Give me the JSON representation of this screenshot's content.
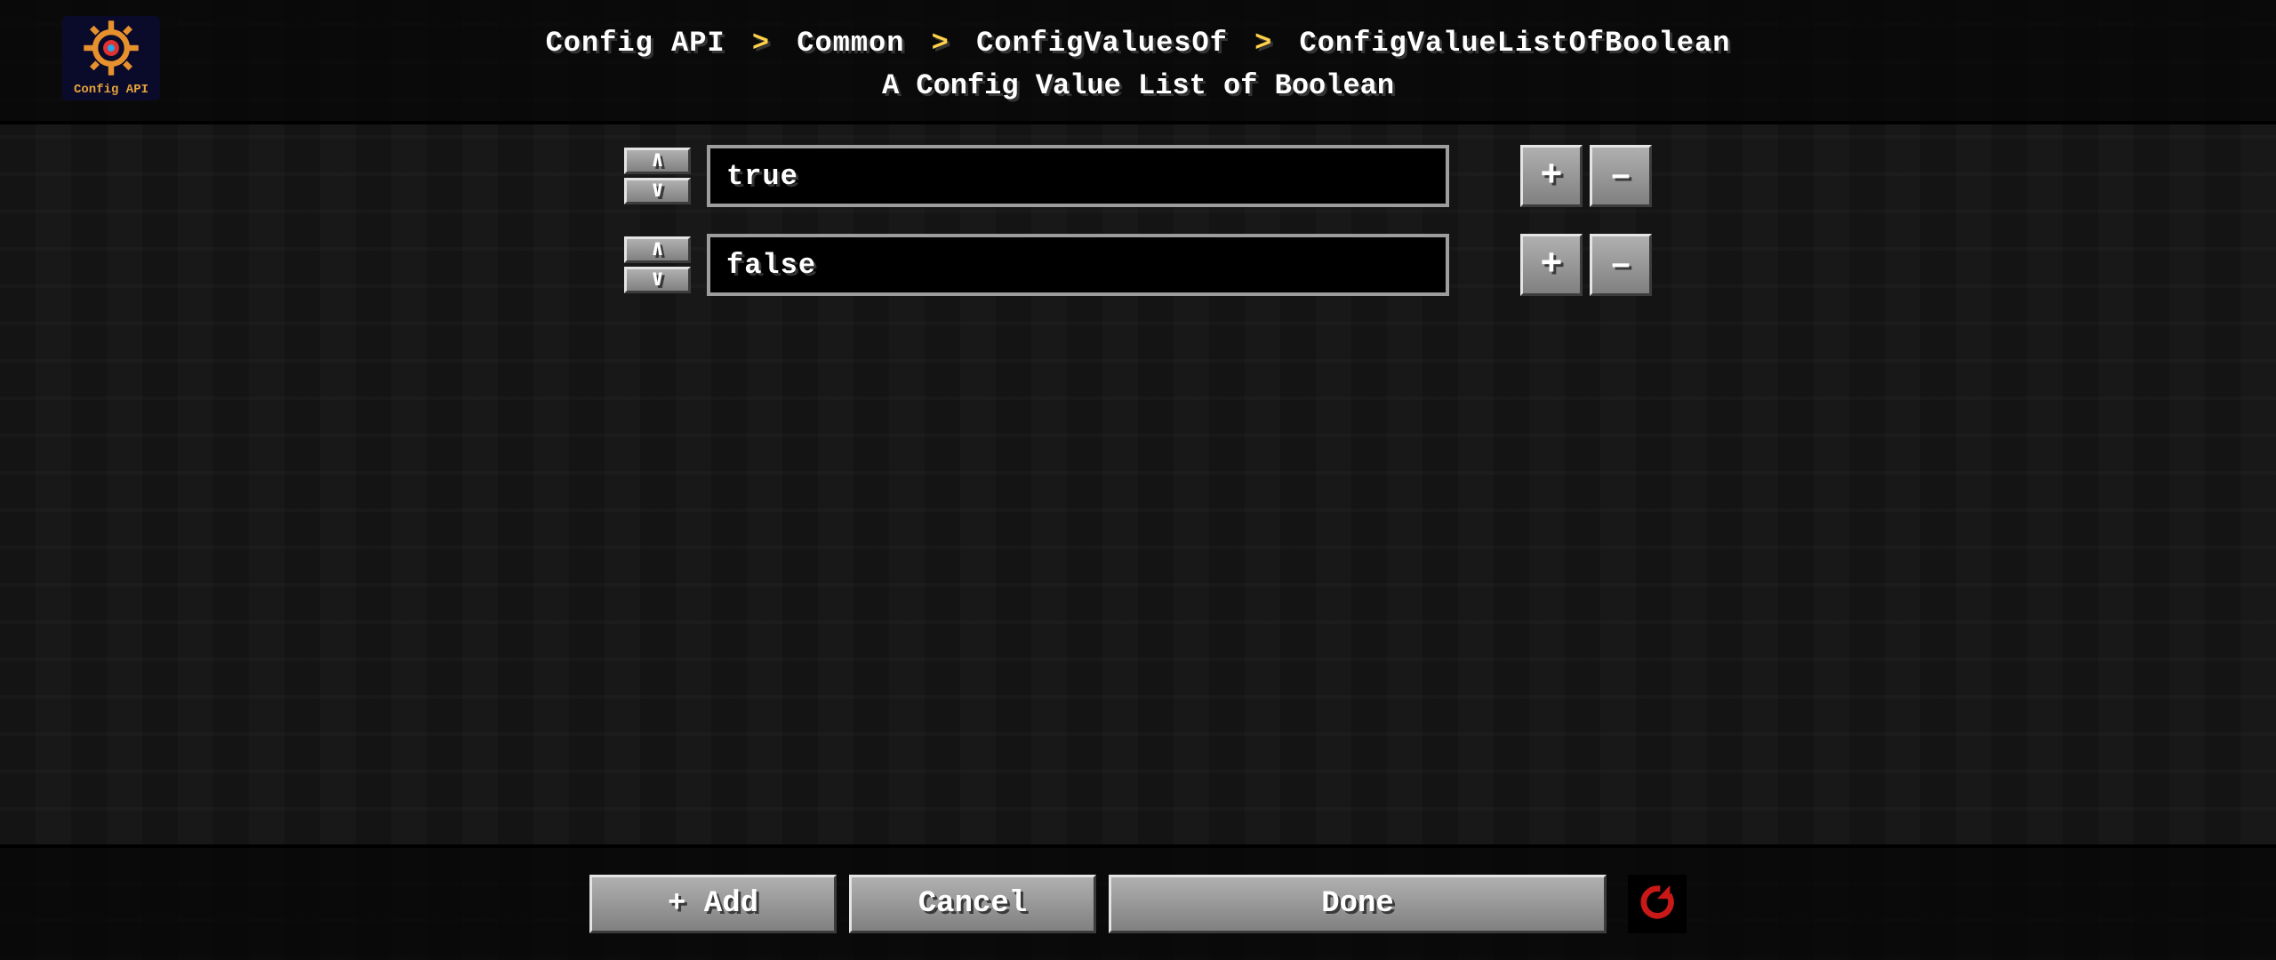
{
  "breadcrumb": {
    "items": [
      "Config API",
      "Common",
      "ConfigValuesOf",
      "ConfigValueListOfBoolean"
    ],
    "separator_glyph": ">"
  },
  "subtitle": "A Config Value List of Boolean",
  "mod_logo": {
    "label": "Config API"
  },
  "entries": [
    {
      "value": "true"
    },
    {
      "value": "false"
    }
  ],
  "row_buttons": {
    "move_up_glyph": "∧",
    "move_down_glyph": "∨",
    "add_glyph": "+",
    "remove_glyph": "–"
  },
  "footer": {
    "add_label": "+ Add",
    "cancel_label": "Cancel",
    "done_label": "Done"
  },
  "icons": {
    "reset": "reset-icon",
    "gear": "gear-icon"
  }
}
